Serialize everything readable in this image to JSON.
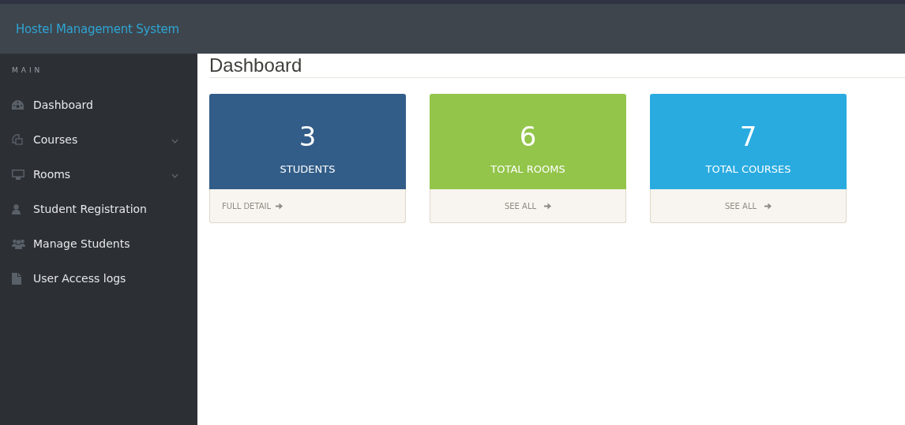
{
  "header": {
    "title": "Hostel Management System"
  },
  "sidebar": {
    "section": "MAIN",
    "items": [
      {
        "label": "Dashboard",
        "kind": "link"
      },
      {
        "label": "Courses",
        "kind": "submenu",
        "expanded": false
      },
      {
        "label": "Rooms",
        "kind": "submenu",
        "expanded": false
      },
      {
        "label": "Student Registration",
        "kind": "link"
      },
      {
        "label": "Manage Students",
        "kind": "link"
      },
      {
        "label": "User Access logs",
        "kind": "link"
      }
    ]
  },
  "page": {
    "title": "Dashboard"
  },
  "cards": [
    {
      "value": "3",
      "label": "STUDENTS",
      "link": "FULL DETAIL",
      "kind": "detail",
      "color": "#325d88"
    },
    {
      "value": "6",
      "label": "TOTAL ROOMS",
      "link": "SEE ALL",
      "kind": "all",
      "color": "#93c54b"
    },
    {
      "value": "7",
      "label": "TOTAL COURSES",
      "link": "SEE ALL",
      "kind": "all",
      "color": "#29abe0"
    }
  ]
}
